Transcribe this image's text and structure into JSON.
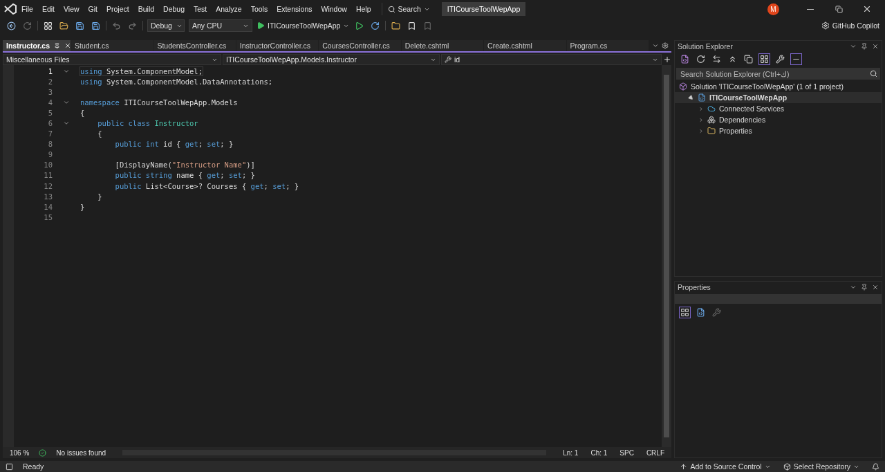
{
  "menu": [
    "File",
    "Edit",
    "View",
    "Git",
    "Project",
    "Build",
    "Debug",
    "Test",
    "Analyze",
    "Tools",
    "Extensions",
    "Window",
    "Help"
  ],
  "search": {
    "label": "Search"
  },
  "solution_title": "ITICourseToolWepApp",
  "avatar": "M",
  "toolbar": {
    "configuration": "Debug",
    "platform": "Any CPU",
    "start_target": "ITICourseToolWepApp",
    "copilot": "GitHub Copilot"
  },
  "tabs": [
    {
      "label": "Instructor.cs",
      "selected": true
    },
    {
      "label": "Student.cs",
      "selected": false
    },
    {
      "label": "StudentsController.cs",
      "selected": false
    },
    {
      "label": "InstructorController.cs",
      "selected": false
    },
    {
      "label": "CoursesController.cs",
      "selected": false
    },
    {
      "label": "Delete.cshtml",
      "selected": false
    },
    {
      "label": "Create.cshtml",
      "selected": false
    },
    {
      "label": "Program.cs",
      "selected": false
    }
  ],
  "nav": {
    "project": "Miscellaneous Files",
    "type": "ITICourseToolWepApp.Models.Instructor",
    "member": "id"
  },
  "code": [
    {
      "number": "1",
      "fold": true,
      "current": true,
      "tokens": [
        {
          "kind": "kw",
          "text": "using"
        },
        {
          "kind": "plain",
          "text": " System.ComponentModel;"
        }
      ]
    },
    {
      "number": "2",
      "fold": false,
      "current": false,
      "tokens": [
        {
          "kind": "kw",
          "text": "using"
        },
        {
          "kind": "plain",
          "text": " System.ComponentModel.DataAnnotations;"
        }
      ]
    },
    {
      "number": "3",
      "fold": false,
      "current": false
    },
    {
      "number": "4",
      "fold": true,
      "current": false,
      "tokens": [
        {
          "kind": "kw",
          "text": "namespace"
        },
        {
          "kind": "plain",
          "text": " ITICourseToolWepApp.Models"
        }
      ]
    },
    {
      "number": "5",
      "fold": false,
      "current": false,
      "tokens": [
        {
          "kind": "plain",
          "text": "{"
        }
      ]
    },
    {
      "number": "6",
      "fold": true,
      "current": false,
      "tokens": [
        {
          "kind": "kw",
          "text": "    public class"
        },
        {
          "kind": "type",
          "text": " Instructor"
        }
      ]
    },
    {
      "number": "7",
      "fold": false,
      "current": false,
      "tokens": [
        {
          "kind": "plain",
          "text": "    {"
        }
      ]
    },
    {
      "number": "8",
      "fold": false,
      "current": false,
      "tokens": [
        {
          "kind": "kw",
          "text": "        public int"
        },
        {
          "kind": "plain",
          "text": " id { "
        },
        {
          "kind": "kw",
          "text": "get"
        },
        {
          "kind": "plain",
          "text": "; "
        },
        {
          "kind": "kw",
          "text": "set"
        },
        {
          "kind": "plain",
          "text": "; }"
        }
      ]
    },
    {
      "number": "9",
      "fold": false,
      "current": false
    },
    {
      "number": "10",
      "fold": false,
      "current": false,
      "tokens": [
        {
          "kind": "plain",
          "text": "        [DisplayName("
        },
        {
          "kind": "str",
          "text": "\"Instructor Name\""
        },
        {
          "kind": "plain",
          "text": ")]"
        }
      ]
    },
    {
      "number": "11",
      "fold": false,
      "current": false,
      "tokens": [
        {
          "kind": "kw",
          "text": "        public string"
        },
        {
          "kind": "plain",
          "text": " name { "
        },
        {
          "kind": "kw",
          "text": "get"
        },
        {
          "kind": "plain",
          "text": "; "
        },
        {
          "kind": "kw",
          "text": "set"
        },
        {
          "kind": "plain",
          "text": "; }"
        }
      ]
    },
    {
      "number": "12",
      "fold": false,
      "current": false,
      "tokens": [
        {
          "kind": "kw",
          "text": "        public"
        },
        {
          "kind": "plain",
          "text": " List<Course>? Courses { "
        },
        {
          "kind": "kw",
          "text": "get"
        },
        {
          "kind": "plain",
          "text": "; "
        },
        {
          "kind": "kw",
          "text": "set"
        },
        {
          "kind": "plain",
          "text": "; }"
        }
      ]
    },
    {
      "number": "13",
      "fold": false,
      "current": false,
      "tokens": [
        {
          "kind": "plain",
          "text": "    }"
        }
      ]
    },
    {
      "number": "14",
      "fold": false,
      "current": false,
      "tokens": [
        {
          "kind": "plain",
          "text": "}"
        }
      ]
    },
    {
      "number": "15",
      "fold": false,
      "current": false
    }
  ],
  "editor_status": {
    "zoom": "106 %",
    "issues": "No issues found",
    "line": "Ln: 1",
    "column": "Ch: 1",
    "whitespace": "SPC",
    "line_ending": "CRLF"
  },
  "solution_explorer": {
    "title": "Solution Explorer",
    "search_placeholder": "Search Solution Explorer (Ctrl+ك)",
    "tree": [
      {
        "label": "Solution 'ITICourseToolWepApp' (1 of 1 project)",
        "kind": "solution",
        "children": [
          {
            "label": "ITICourseToolWepApp",
            "kind": "project",
            "expanded": true,
            "selected": true,
            "children": [
              {
                "label": "Connected Services",
                "kind": "services",
                "expanded": false,
                "selected": false
              },
              {
                "label": "Dependencies",
                "kind": "dependencies",
                "expanded": false,
                "selected": false
              },
              {
                "label": "Properties",
                "kind": "properties",
                "expanded": false,
                "selected": false
              }
            ]
          }
        ]
      }
    ]
  },
  "properties": {
    "title": "Properties"
  },
  "status_bar": {
    "state": "Ready",
    "source_control": "Add to Source Control",
    "repository": "Select Repository"
  }
}
